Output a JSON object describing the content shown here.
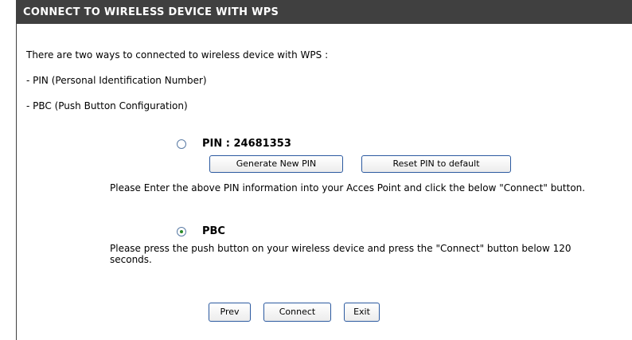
{
  "header": {
    "title": "CONNECT TO WIRELESS DEVICE WITH WPS"
  },
  "intro": {
    "line1": "There are two ways to connected to wireless device with WPS :",
    "line2": "- PIN (Personal Identification Number)",
    "line3": "- PBC (Push Button Configuration)"
  },
  "pin_option": {
    "label": "PIN : 24681353",
    "selected": false,
    "generate_button": "Generate New PIN",
    "reset_button": "Reset PIN to default",
    "description": "Please Enter the above PIN information into your Acces Point and click the below \"Connect\" button."
  },
  "pbc_option": {
    "label": "PBC",
    "selected": true,
    "description": "Please press the push button on your wireless device and press the \"Connect\" button below 120 seconds."
  },
  "footer_buttons": {
    "prev": "Prev",
    "connect": "Connect",
    "exit": "Exit"
  }
}
